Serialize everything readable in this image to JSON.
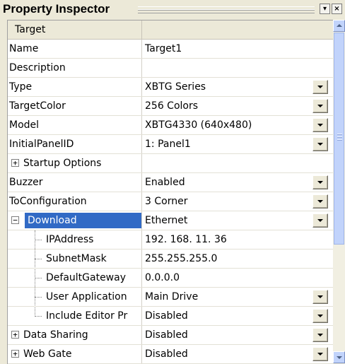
{
  "title": "Property Inspector",
  "header": "Target",
  "props": {
    "name": {
      "label": "Name",
      "value": "Target1"
    },
    "description": {
      "label": "Description",
      "value": ""
    },
    "type": {
      "label": "Type",
      "value": "XBTG Series"
    },
    "target_color": {
      "label": "TargetColor",
      "value": "256 Colors"
    },
    "model": {
      "label": "Model",
      "value": "XBTG4330 (640x480)"
    },
    "initial_panel": {
      "label": "InitialPanelID",
      "value": "1: Panel1"
    },
    "startup_options": {
      "label": "Startup Options",
      "value": ""
    },
    "buzzer": {
      "label": "Buzzer",
      "value": "Enabled"
    },
    "to_configuration": {
      "label": "ToConfiguration",
      "value": "3 Corner"
    },
    "download": {
      "label": "Download",
      "value": "Ethernet"
    },
    "ip_address": {
      "label": "IPAddress",
      "value": "192. 168. 11. 36"
    },
    "subnet_mask": {
      "label": "SubnetMask",
      "value": "255.255.255.0"
    },
    "default_gateway": {
      "label": "DefaultGateway",
      "value": "0.0.0.0"
    },
    "user_application": {
      "label": "User Application",
      "value": "Main Drive"
    },
    "include_editor": {
      "label": "Include Editor Pr",
      "value": "Disabled"
    },
    "data_sharing": {
      "label": "Data Sharing",
      "value": "Disabled"
    },
    "web_gate": {
      "label": "Web Gate",
      "value": "Disabled"
    }
  },
  "colors": {
    "selection": "#316ac5",
    "panel": "#ece9d8",
    "scrollbar": "#c1d3fb"
  },
  "icons": {
    "expand": "plus-box",
    "collapse": "minus-box",
    "dropdown": "down-triangle",
    "pin": "pin-icon",
    "close": "close-icon"
  },
  "scroll_position": 0
}
